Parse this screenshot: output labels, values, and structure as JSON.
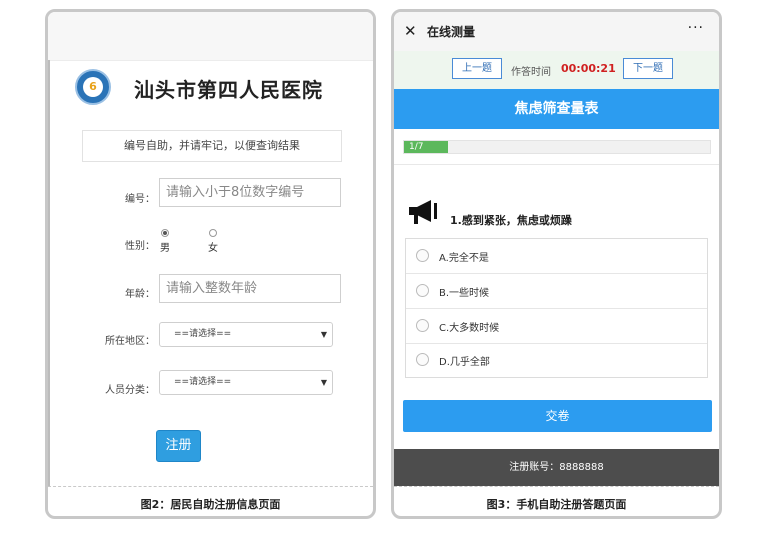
{
  "left": {
    "hospital_name": "汕头市第四人民医院",
    "logo_glyph": "6",
    "notice": "编号自助，并请牢记，以便查询结果",
    "id_label": "编号：",
    "id_placeholder": "请输入小于8位数字编号",
    "gender_label": "性别：",
    "gender_options": [
      "男",
      "女"
    ],
    "gender_selected": "男",
    "age_label": "年龄：",
    "age_placeholder": "请输入整数年龄",
    "region_label": "所在地区：",
    "region_value": "==请选择==",
    "category_label": "人员分类：",
    "category_value": "==请选择==",
    "submit_label": "注册",
    "caption": "图2：居民自助注册信息页面"
  },
  "right": {
    "title": "在线测量",
    "close_icon": "close-icon",
    "more_icon": "more-icon",
    "prev_label": "上一题",
    "timer_label": "作答时间",
    "timer_value": "00:00:21",
    "next_label": "下一题",
    "survey_title": "焦虑筛查量表",
    "progress_text": "1/7",
    "progress_fraction": 0.143,
    "question": "1.感到紧张，焦虑或烦躁",
    "options": [
      "A.完全不是",
      "B.一些时候",
      "C.大多数时候",
      "D.几乎全部"
    ],
    "submit_label": "交卷",
    "account": "注册账号：8888888",
    "caption": "图3：手机自助注册答题页面"
  },
  "colors": {
    "accent_blue": "#2c9cf0",
    "timer_red": "#d02020",
    "progress_green": "#5cb85c",
    "account_bar": "#4d4d4d"
  }
}
